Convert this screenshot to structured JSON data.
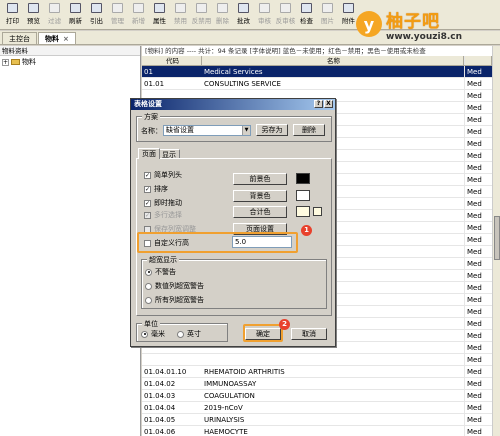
{
  "toolbar": {
    "buttons": [
      {
        "label": "打印",
        "disabled": false
      },
      {
        "label": "预览",
        "disabled": false
      },
      {
        "label": "过滤",
        "disabled": true
      },
      {
        "label": "刷新",
        "disabled": false
      },
      {
        "label": "引出",
        "disabled": false
      },
      {
        "label": "管理",
        "disabled": true
      },
      {
        "label": "新增",
        "disabled": true
      },
      {
        "label": "属性",
        "disabled": false
      },
      {
        "label": "禁用",
        "disabled": true
      },
      {
        "label": "反禁用",
        "disabled": true
      },
      {
        "label": "删除",
        "disabled": true
      },
      {
        "label": "批改",
        "disabled": false
      },
      {
        "label": "审核",
        "disabled": true
      },
      {
        "label": "反审核",
        "disabled": true
      },
      {
        "label": "检查",
        "disabled": false
      },
      {
        "label": "图片",
        "disabled": true
      },
      {
        "label": "附件",
        "disabled": false
      }
    ]
  },
  "tabs": [
    {
      "label": "主控台",
      "active": false
    },
    {
      "label": "物料",
      "active": true
    }
  ],
  "left_panel": {
    "title": "物料资料",
    "tree_root": "物料"
  },
  "right_panel": {
    "info": "[物料] 的内容 ---- 共计：94 条记录   [字体说明] 蓝色－未使用；红色－禁用；黑色－使用或未检查",
    "columns": [
      "代码",
      "名称",
      ""
    ],
    "rows": [
      {
        "code": "01",
        "name": "Medical Services",
        "extra": "Med",
        "selected": true
      },
      {
        "code": "01.01",
        "name": "CONSULTING SERVICE",
        "extra": "Med",
        "selected": false
      },
      {
        "code": "",
        "name": "",
        "extra": "Med",
        "selected": false
      },
      {
        "code": "",
        "name": "",
        "extra": "Med",
        "selected": false
      },
      {
        "code": "",
        "name": "",
        "extra": "Med",
        "selected": false
      },
      {
        "code": "",
        "name": "",
        "extra": "Med",
        "selected": false
      },
      {
        "code": "",
        "name": "",
        "extra": "Med",
        "selected": false
      },
      {
        "code": "",
        "name": "",
        "extra": "Med",
        "selected": false
      },
      {
        "code": "",
        "name": "",
        "extra": "Med",
        "selected": false
      },
      {
        "code": "",
        "name": "",
        "extra": "Med",
        "selected": false
      },
      {
        "code": "",
        "name": "",
        "extra": "Med",
        "selected": false
      },
      {
        "code": "",
        "name": "",
        "extra": "Med",
        "selected": false
      },
      {
        "code": "",
        "name": "",
        "extra": "Med",
        "selected": false
      },
      {
        "code": "",
        "name": "",
        "extra": "Med",
        "selected": false
      },
      {
        "code": "",
        "name": "",
        "extra": "Med",
        "selected": false
      },
      {
        "code": "",
        "name": "",
        "extra": "Med",
        "selected": false
      },
      {
        "code": "",
        "name": "",
        "extra": "Med",
        "selected": false
      },
      {
        "code": "",
        "name": "",
        "extra": "Med",
        "selected": false
      },
      {
        "code": "",
        "name": "",
        "extra": "Med",
        "selected": false
      },
      {
        "code": "",
        "name": "",
        "extra": "Med",
        "selected": false
      },
      {
        "code": "",
        "name": "",
        "extra": "Med",
        "selected": false
      },
      {
        "code": "",
        "name": "",
        "extra": "Med",
        "selected": false
      },
      {
        "code": "",
        "name": "",
        "extra": "Med",
        "selected": false
      },
      {
        "code": "",
        "name": "",
        "extra": "Med",
        "selected": false
      },
      {
        "code": "",
        "name": "",
        "extra": "Med",
        "selected": false
      },
      {
        "code": "01.04.01.10",
        "name": "RHEMATOID ARTHRITIS",
        "extra": "Med",
        "selected": false
      },
      {
        "code": "01.04.02",
        "name": "IMMUNOASSAY",
        "extra": "Med",
        "selected": false
      },
      {
        "code": "01.04.03",
        "name": "COAGULATION",
        "extra": "Med",
        "selected": false
      },
      {
        "code": "01.04.04",
        "name": "2019-nCoV",
        "extra": "Med",
        "selected": false
      },
      {
        "code": "01.04.05",
        "name": "URINALYSIS",
        "extra": "Med",
        "selected": false
      },
      {
        "code": "01.04.06",
        "name": "HAEMOCYTE",
        "extra": "Med",
        "selected": false
      }
    ]
  },
  "watermark": {
    "mark": "y",
    "name": "柚子吧",
    "url": "www.youzi8.cn"
  },
  "dialog": {
    "title": "表格设置",
    "title_buttons": [
      "?",
      "X"
    ],
    "scheme_legend": "方案",
    "name_label": "名称：",
    "name_value": "缺省设置",
    "save_as_label": "另存为",
    "delete_label": "删除",
    "tab_page": "页面",
    "tab_display": "显示",
    "checks": [
      {
        "label": "简单列头",
        "checked": true,
        "disabled": false
      },
      {
        "label": "排序",
        "checked": true,
        "disabled": false
      },
      {
        "label": "即时拖动",
        "checked": true,
        "disabled": false
      },
      {
        "label": "多行选择",
        "checked": true,
        "disabled": true
      },
      {
        "label": "保存列宽调整",
        "checked": false,
        "disabled": true
      },
      {
        "label": "自定义行高",
        "checked": false,
        "disabled": false
      }
    ],
    "fg_color_label": "前景色",
    "bg_color_label": "背景色",
    "total_color_label": "合计色",
    "page_setup_label": "页面设置",
    "row_height_value": "5.0",
    "fg_color": "#000000",
    "bg_color": "#ffffff",
    "total_color": "#fffbe0",
    "overflow_legend": "超宽显示",
    "overflow_options": [
      {
        "label": "不警告",
        "selected": true
      },
      {
        "label": "数值列超宽警告",
        "selected": false
      },
      {
        "label": "所有列超宽警告",
        "selected": false
      }
    ],
    "unit_legend": "单位",
    "unit_options": [
      {
        "label": "毫米",
        "selected": true
      },
      {
        "label": "英寸",
        "selected": false
      }
    ],
    "ok_label": "确定",
    "cancel_label": "取消"
  },
  "markers": [
    "1",
    "2"
  ],
  "highlight_color": "#f0a030",
  "marker_color": "#e8412c"
}
